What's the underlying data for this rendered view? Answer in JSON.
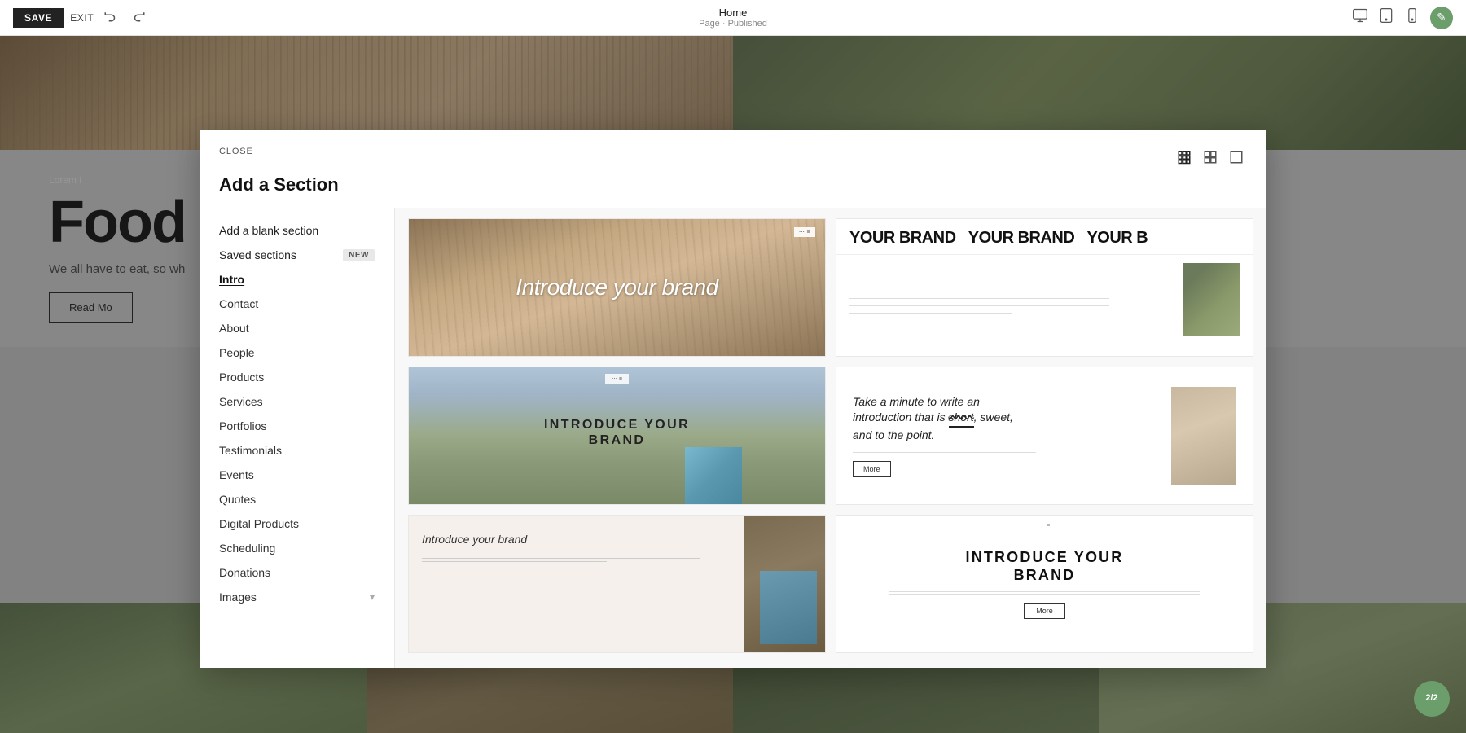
{
  "toolbar": {
    "save_label": "SAVE",
    "exit_label": "EXIT",
    "page_name": "Home",
    "page_status": "Page · Published"
  },
  "modal": {
    "close_label": "CLOSE",
    "title": "Add a Section",
    "sidebar_items": [
      {
        "id": "add-blank",
        "label": "Add a blank section",
        "badge": null,
        "special": true
      },
      {
        "id": "saved-sections",
        "label": "Saved sections",
        "badge": "NEW",
        "special": true
      },
      {
        "id": "intro",
        "label": "Intro",
        "active": true
      },
      {
        "id": "contact",
        "label": "Contact"
      },
      {
        "id": "about",
        "label": "About"
      },
      {
        "id": "people",
        "label": "People"
      },
      {
        "id": "products",
        "label": "Products"
      },
      {
        "id": "services",
        "label": "Services"
      },
      {
        "id": "portfolios",
        "label": "Portfolios"
      },
      {
        "id": "testimonials",
        "label": "Testimonials"
      },
      {
        "id": "events",
        "label": "Events"
      },
      {
        "id": "quotes",
        "label": "Quotes"
      },
      {
        "id": "digital-products",
        "label": "Digital Products"
      },
      {
        "id": "scheduling",
        "label": "Scheduling"
      },
      {
        "id": "donations",
        "label": "Donations"
      },
      {
        "id": "images",
        "label": "Images"
      }
    ],
    "templates": [
      {
        "id": "tpl-hero-wheat",
        "text": "Introduce your brand",
        "type": "hero-wheat"
      },
      {
        "id": "tpl-brand-marquee",
        "text": "YOUR BRAND  YOUR BRAND  YOUR B",
        "type": "brand-marquee"
      },
      {
        "id": "tpl-mountain-overlay",
        "text": "INTRODUCE YOUR BRAND",
        "type": "mountain-overlay"
      },
      {
        "id": "tpl-text-image",
        "headline": "Take a minute to write an introduction that is short, sweet, and to the point.",
        "button": "More",
        "type": "text-image"
      },
      {
        "id": "tpl-text-left-img-right",
        "text": "Introduce your brand",
        "type": "text-left-img-right"
      },
      {
        "id": "tpl-white-intro",
        "text": "INTRODUCE YOUR BRAND",
        "type": "white-intro"
      }
    ],
    "view_icons": [
      "grid-3",
      "grid-2",
      "single"
    ]
  },
  "bg": {
    "food_title": "Food",
    "food_sub": "We all have to eat, so wh",
    "read_more": "Read Mo",
    "lorem": "Lorem i"
  },
  "page_badge": {
    "label": "2/2"
  }
}
